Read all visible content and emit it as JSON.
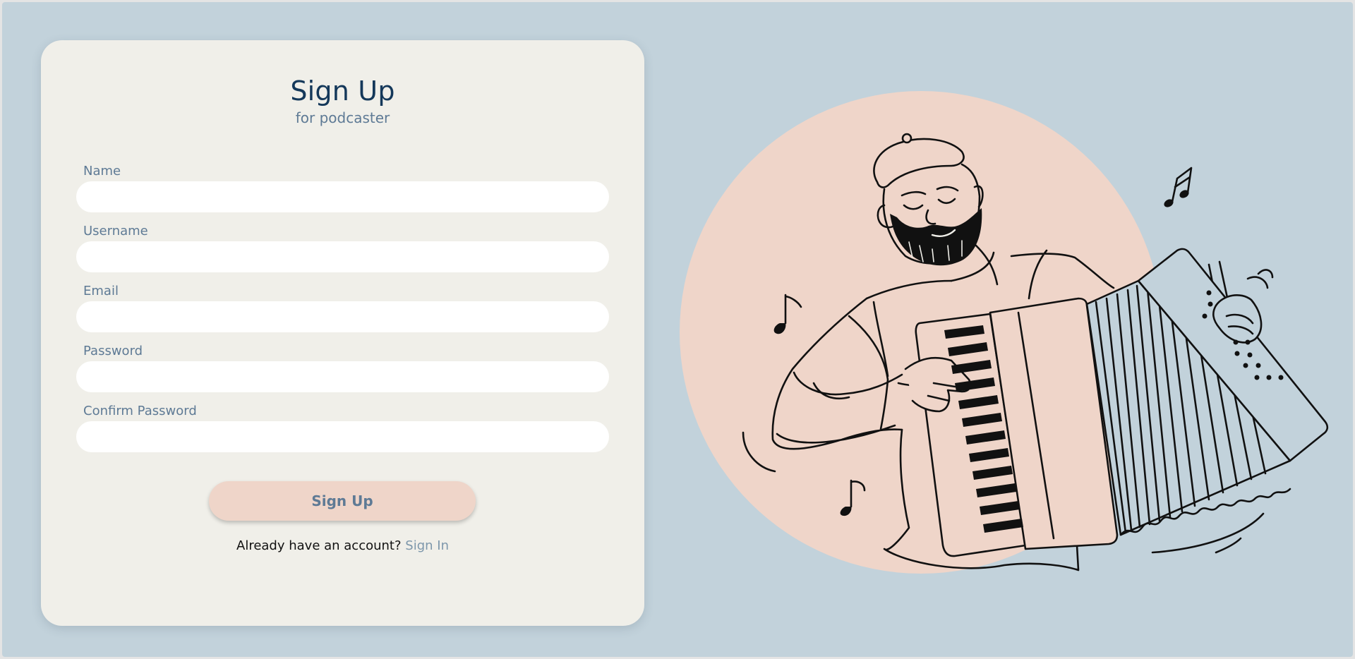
{
  "form": {
    "title": "Sign Up",
    "subtitle": "for podcaster",
    "fields": [
      {
        "label": "Name",
        "value": ""
      },
      {
        "label": "Username",
        "value": ""
      },
      {
        "label": "Email",
        "value": ""
      },
      {
        "label": "Password",
        "value": ""
      },
      {
        "label": "Confirm Password",
        "value": ""
      }
    ],
    "submit_label": "Sign Up",
    "signin_prompt": "Already have an account?",
    "signin_link": "Sign In"
  },
  "colors": {
    "page_background": "#c2d2db",
    "card_background": "#f0efe9",
    "title": "#14385a",
    "label": "#5e7a95",
    "button_background": "#efd5c9",
    "illustration_circle": "#efd5c9"
  },
  "illustration": {
    "icon": "accordion-player-illustration"
  }
}
